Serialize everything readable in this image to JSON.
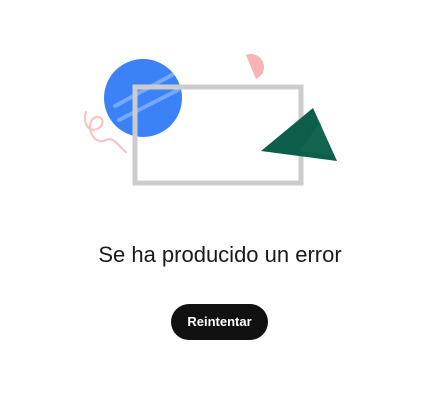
{
  "illustration": {
    "icon": "error-illustration-icon",
    "colors": {
      "circle": "#3b82f6",
      "frame": "#cccccc",
      "triangle": "#0d5e4a",
      "semicircle": "#f8b4b4",
      "squiggle": "#f8c4c4"
    }
  },
  "error": {
    "message": "Se ha producido un error"
  },
  "actions": {
    "retry_label": "Reintentar"
  }
}
